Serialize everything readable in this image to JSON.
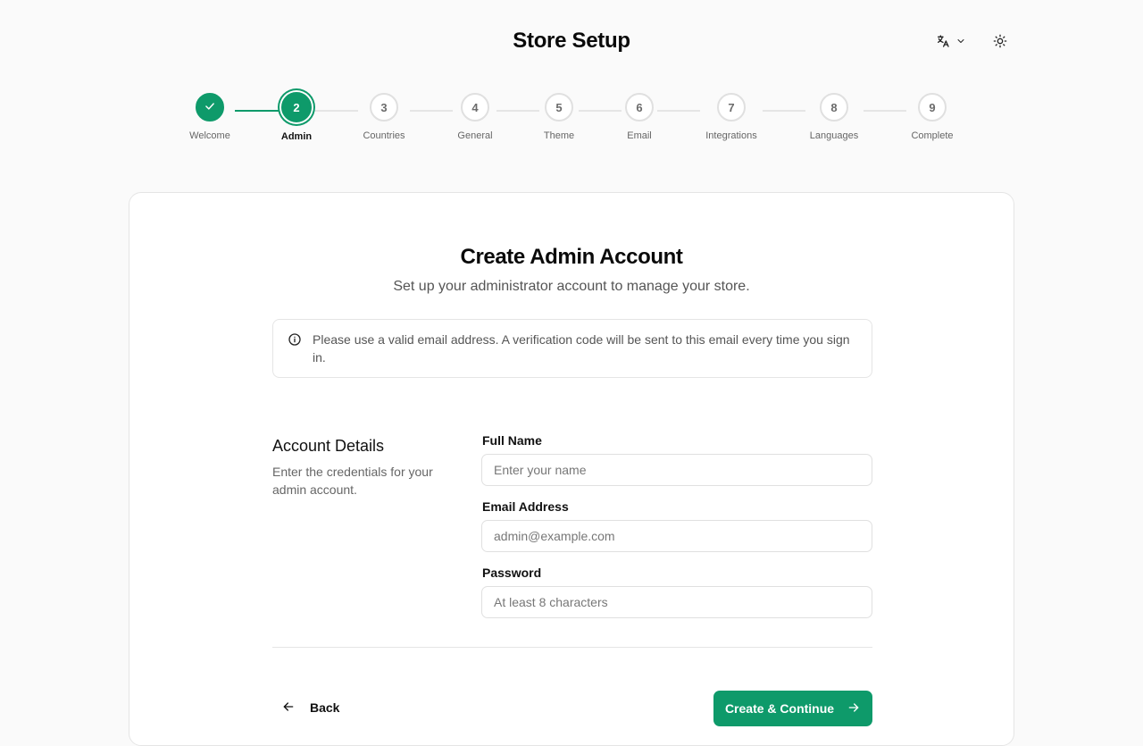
{
  "header": {
    "title": "Store Setup",
    "language_icon": "translate-icon",
    "theme_icon": "sun-icon"
  },
  "steps": [
    {
      "number": "1",
      "label": "Welcome",
      "state": "completed"
    },
    {
      "number": "2",
      "label": "Admin",
      "state": "active"
    },
    {
      "number": "3",
      "label": "Countries",
      "state": "pending"
    },
    {
      "number": "4",
      "label": "General",
      "state": "pending"
    },
    {
      "number": "5",
      "label": "Theme",
      "state": "pending"
    },
    {
      "number": "6",
      "label": "Email",
      "state": "pending"
    },
    {
      "number": "7",
      "label": "Integrations",
      "state": "pending"
    },
    {
      "number": "8",
      "label": "Languages",
      "state": "pending"
    },
    {
      "number": "9",
      "label": "Complete",
      "state": "pending"
    }
  ],
  "card": {
    "title": "Create Admin Account",
    "subtitle": "Set up your administrator account to manage your store.",
    "alert": "Please use a valid email address. A verification code will be sent to this email every time you sign in."
  },
  "form": {
    "section_title": "Account Details",
    "section_desc": "Enter the credentials for your admin account.",
    "full_name": {
      "label": "Full Name",
      "placeholder": "Enter your name",
      "value": ""
    },
    "email": {
      "label": "Email Address",
      "placeholder": "admin@example.com",
      "value": ""
    },
    "password": {
      "label": "Password",
      "placeholder": "At least 8 characters",
      "value": ""
    }
  },
  "actions": {
    "back_label": "Back",
    "continue_label": "Create & Continue"
  },
  "colors": {
    "accent": "#0e9a6a",
    "border": "#e5e5e5",
    "background": "#fafafa"
  }
}
